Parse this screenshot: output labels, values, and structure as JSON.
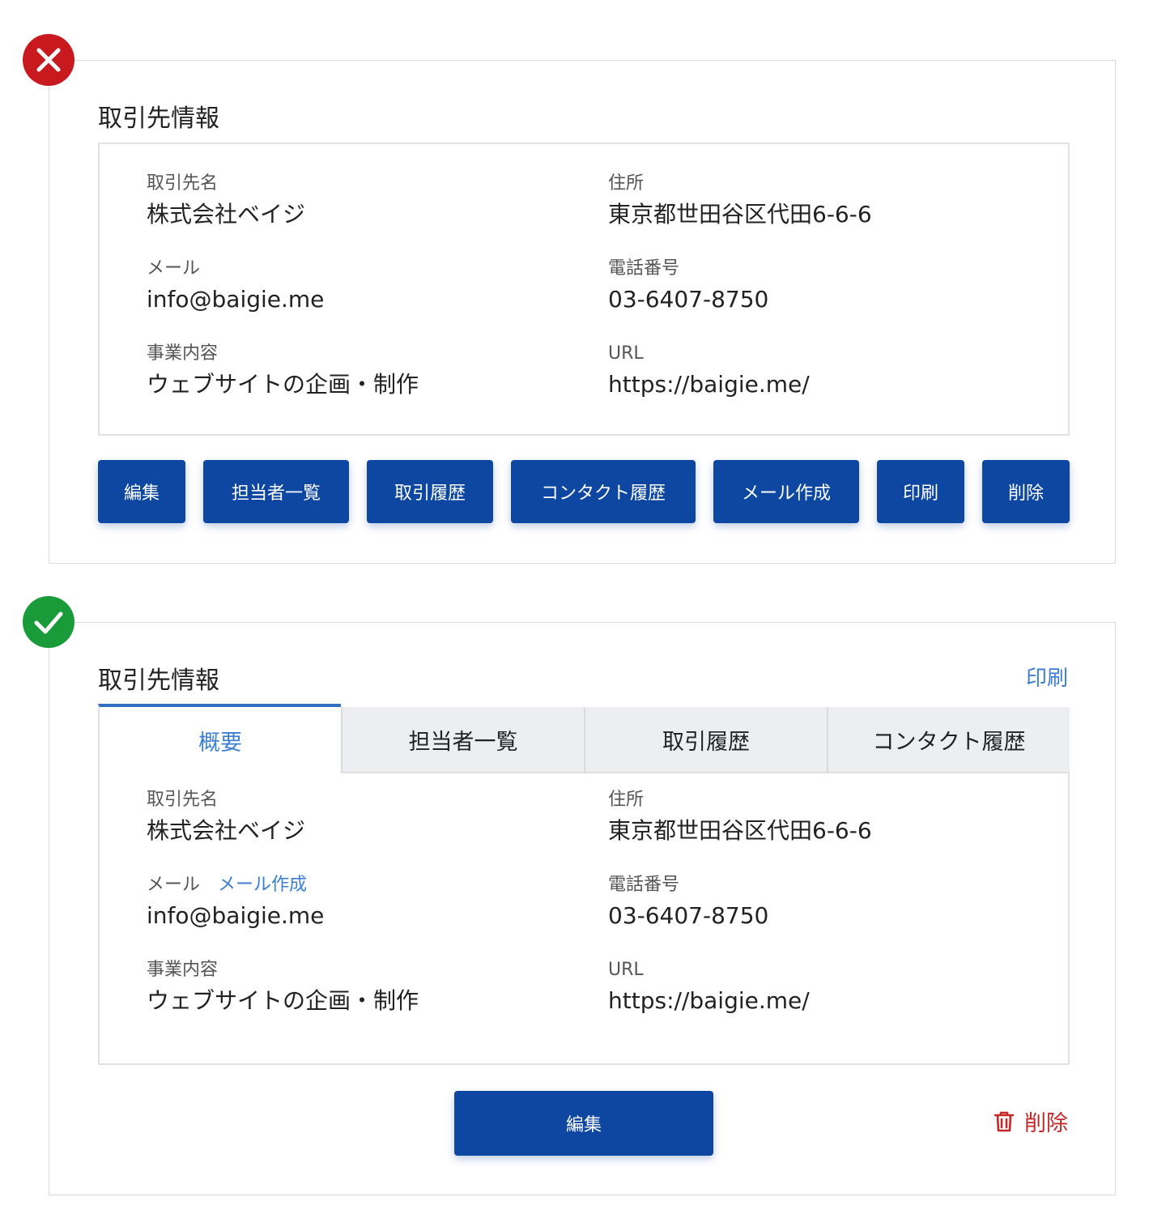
{
  "colors": {
    "primary": "#0d47a1",
    "link": "#3b7fd4",
    "danger": "#c62828",
    "bad_badge": "#c8191e",
    "good_badge": "#1a9b3a"
  },
  "bad_example": {
    "badge_icon": "close-icon",
    "title": "取引先情報",
    "fields": {
      "name_label": "取引先名",
      "name_value": "株式会社ベイジ",
      "address_label": "住所",
      "address_value": "東京都世田谷区代田6-6-6",
      "mail_label": "メール",
      "mail_value": "info@baigie.me",
      "phone_label": "電話番号",
      "phone_value": "03-6407-8750",
      "business_label": "事業内容",
      "business_value": "ウェブサイトの企画・制作",
      "url_label": "URL",
      "url_value": "https://baigie.me/"
    },
    "buttons": {
      "edit": "編集",
      "contacts": "担当者一覧",
      "history": "取引履歴",
      "contact_history": "コンタクト履歴",
      "compose_mail": "メール作成",
      "print": "印刷",
      "delete": "削除"
    }
  },
  "good_example": {
    "badge_icon": "check-icon",
    "title": "取引先情報",
    "print_link": "印刷",
    "tabs": {
      "overview": "概要",
      "contacts": "担当者一覧",
      "history": "取引履歴",
      "contact_history": "コンタクト履歴"
    },
    "fields": {
      "name_label": "取引先名",
      "name_value": "株式会社ベイジ",
      "address_label": "住所",
      "address_value": "東京都世田谷区代田6-6-6",
      "mail_label": "メール",
      "mail_action": "メール作成",
      "mail_value": "info@baigie.me",
      "phone_label": "電話番号",
      "phone_value": "03-6407-8750",
      "business_label": "事業内容",
      "business_value": "ウェブサイトの企画・制作",
      "url_label": "URL",
      "url_value": "https://baigie.me/"
    },
    "edit_button": "編集",
    "delete_link": "削除",
    "delete_icon": "trash-icon"
  }
}
